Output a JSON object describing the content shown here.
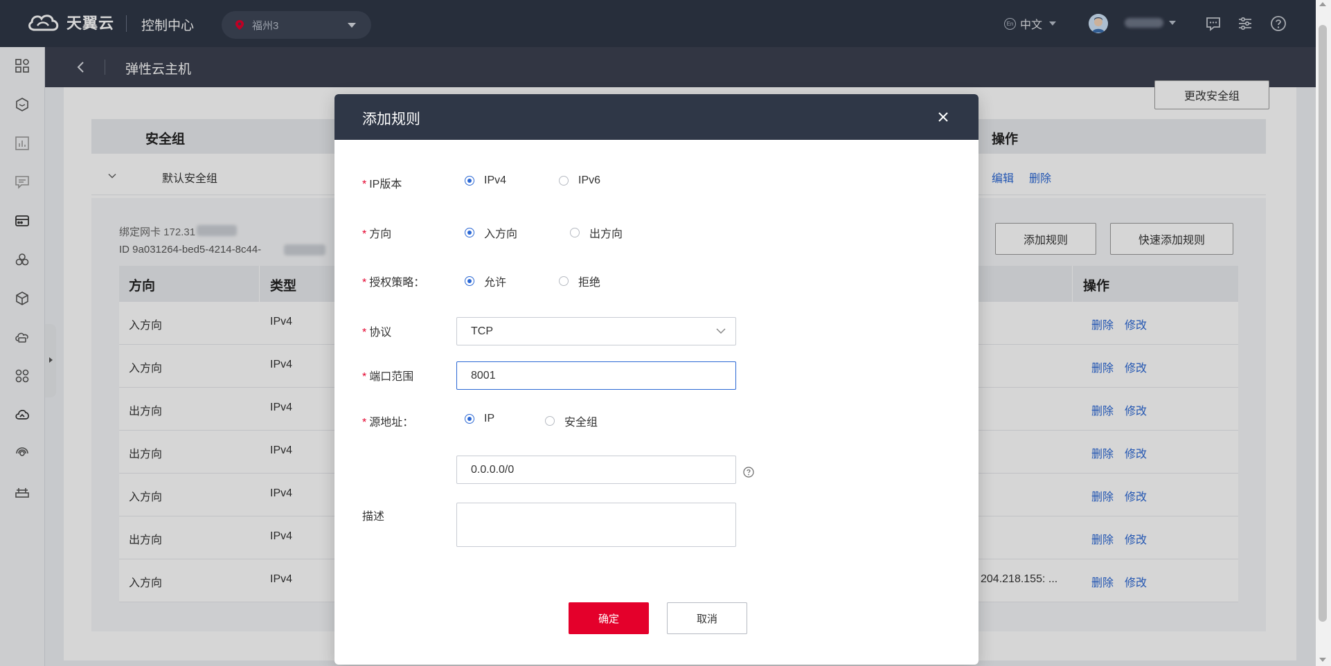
{
  "header": {
    "logo_text": "天翼云",
    "console_title": "控制中心",
    "region": "福州3",
    "language": "中文",
    "lang_badge": "En"
  },
  "subheader": {
    "title": "弹性云主机"
  },
  "background": {
    "change_sg_button": "更改安全组",
    "sg_table": {
      "col_name": "安全组",
      "col_action": "操作"
    },
    "sg_row": {
      "name": "默认安全组",
      "edit": "编辑",
      "delete": "删除"
    },
    "nic_label": "绑定网卡 172.31",
    "id_label": "ID 9a031264-bed5-4214-8c44-",
    "add_rule_button": "添加规则",
    "quick_add_rule_button": "快速添加规则",
    "rules_table": {
      "columns": [
        "方向",
        "类型",
        "操作"
      ],
      "rows": [
        {
          "direction": "入方向",
          "type": "IPv4",
          "source": ""
        },
        {
          "direction": "入方向",
          "type": "IPv4",
          "source": ""
        },
        {
          "direction": "出方向",
          "type": "IPv4",
          "source": ""
        },
        {
          "direction": "出方向",
          "type": "IPv4",
          "source": ""
        },
        {
          "direction": "入方向",
          "type": "IPv4",
          "source": ""
        },
        {
          "direction": "出方向",
          "type": "IPv4",
          "source": ""
        },
        {
          "direction": "入方向",
          "type": "IPv4",
          "source": "204.218.155: ..."
        }
      ],
      "delete_label": "删除",
      "modify_label": "修改"
    }
  },
  "modal": {
    "title": "添加规则",
    "ip_version": {
      "label": "IP版本",
      "options": [
        "IPv4",
        "IPv6"
      ],
      "selected": "IPv4"
    },
    "direction": {
      "label": "方向",
      "options": [
        "入方向",
        "出方向"
      ],
      "selected": "入方向"
    },
    "policy": {
      "label": "授权策略：",
      "options": [
        "允许",
        "拒绝"
      ],
      "selected": "允许"
    },
    "protocol": {
      "label": "协议",
      "value": "TCP"
    },
    "port_range": {
      "label": "端口范围",
      "value": "8001"
    },
    "source": {
      "label": "源地址：",
      "options": [
        "IP",
        "安全组"
      ],
      "selected": "IP",
      "value": "0.0.0.0/0"
    },
    "description": {
      "label": "描述",
      "value": ""
    },
    "required_mark": "*",
    "ok_button": "确定",
    "cancel_button": "取消"
  },
  "colors": {
    "brand_red": "#e4002b",
    "header_dark": "#2f3747",
    "link_blue": "#2a67d4"
  }
}
